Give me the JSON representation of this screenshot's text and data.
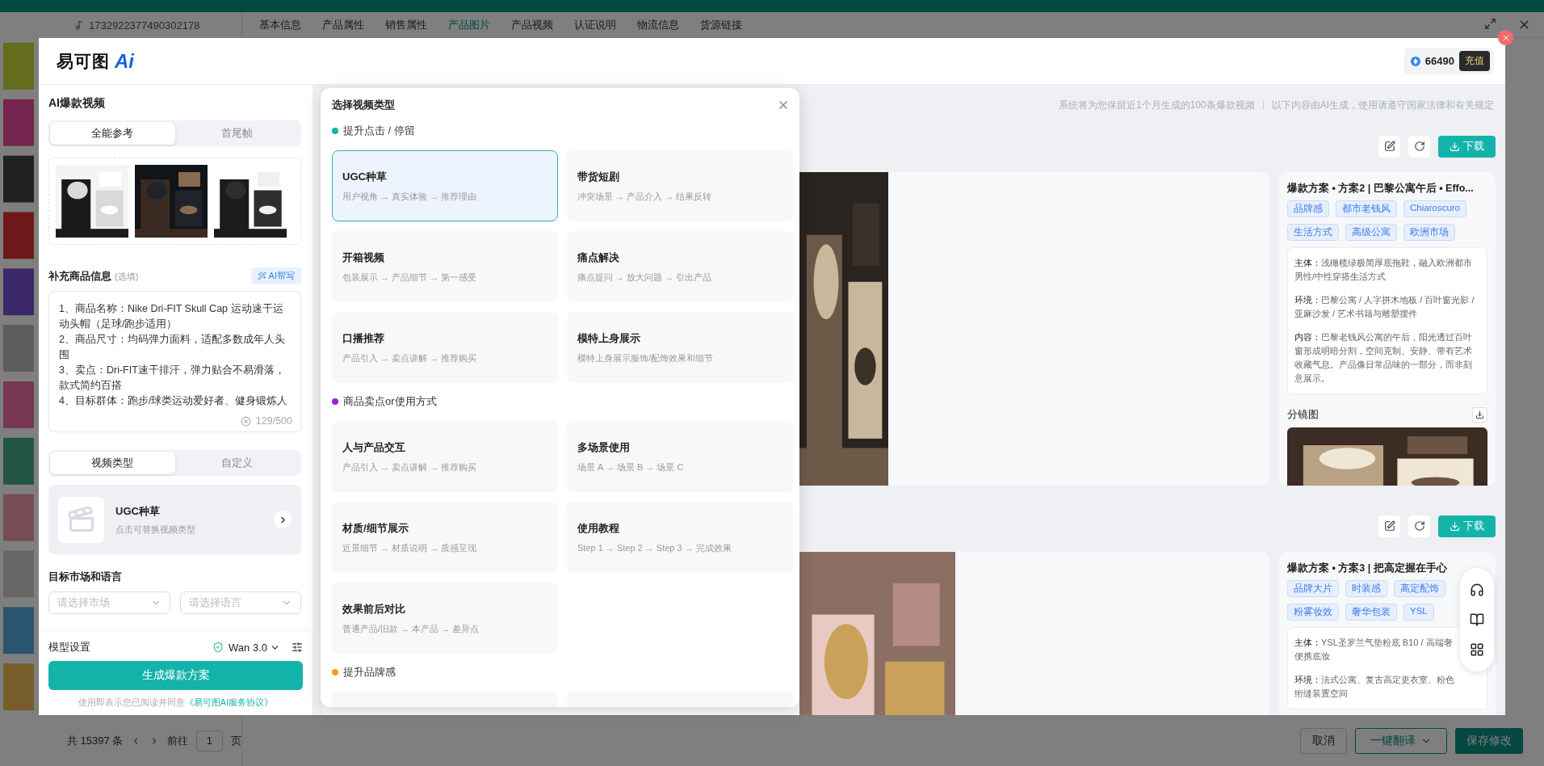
{
  "background_page": {
    "product_id": "1732922377490302178",
    "tabs": [
      {
        "label": "基本信息",
        "selected": false
      },
      {
        "label": "产品属性",
        "selected": false
      },
      {
        "label": "销售属性",
        "selected": false
      },
      {
        "label": "产品图片",
        "selected": true
      },
      {
        "label": "产品视频",
        "selected": false
      },
      {
        "label": "认证说明",
        "selected": false
      },
      {
        "label": "物流信息",
        "selected": false
      },
      {
        "label": "货源链接",
        "selected": false
      }
    ],
    "pagination": {
      "total": "共 15397 条",
      "goto": "前往",
      "page": "1",
      "unit": "页"
    },
    "buttons": [
      {
        "label": "取消",
        "kind": "plain"
      },
      {
        "label": "一键翻译",
        "kind": "dropdown"
      },
      {
        "label": "保存修改",
        "kind": "primary"
      }
    ]
  },
  "modal": {
    "logo": {
      "text": "易可图",
      "mark": "Ai"
    },
    "credits": "66490",
    "recharge": "充值"
  },
  "left_panel": {
    "title": "AI爆款视频",
    "mode_tabs": [
      {
        "label": "全能参考",
        "selected": true
      },
      {
        "label": "首尾帧",
        "selected": false
      }
    ],
    "info": {
      "label": "补充商品信息",
      "hint": "(选填)",
      "ai_button": "AI帮写",
      "value": "1、商品名称：Nike Dri-FIT Skull Cap 运动速干运动头帽（足球/跑步适用）\n2、商品尺寸：均码弹力面料，适配多数成年人头围\n3、卖点：Dri-FIT速干排汗，弹力贴合不易滑落，款式简约百搭\n4、目标群体：跑步/球类运动爱好者、健身锻炼人",
      "counter": "129/500"
    },
    "type_tabs": [
      {
        "label": "视频类型",
        "selected": true
      },
      {
        "label": "自定义",
        "selected": false
      }
    ],
    "selected_type": {
      "name": "UGC种草",
      "hint": "点击可替换视频类型"
    },
    "market": {
      "label": "目标市场和语言",
      "selects": [
        {
          "placeholder": "请选择市场"
        },
        {
          "placeholder": "请选择语言"
        }
      ]
    },
    "model": {
      "label": "模型设置",
      "value": "Wan 3.0"
    },
    "generate_button": "生成爆款方案",
    "agreement": {
      "text": "使用即表示您已阅读并同意",
      "link": "《易可图AI服务协议》"
    }
  },
  "popup": {
    "title": "选择视频类型",
    "sections": [
      {
        "title": "提升点击 / 停留",
        "color": "#14b3aa",
        "cards": [
          {
            "name": "UGC种草",
            "flow": "用户视角 → 真实体验 → 推荐理由",
            "selected": true
          },
          {
            "name": "带货短剧",
            "flow": "冲突场景 → 产品介入 → 结果反转",
            "selected": false
          },
          {
            "name": "开箱视频",
            "flow": "包装展示 → 产品细节 → 第一感受",
            "selected": false
          },
          {
            "name": "痛点解决",
            "flow": "痛点提问 → 放大问题 → 引出产品",
            "selected": false
          },
          {
            "name": "口播推荐",
            "flow": "产品引入 → 卖点讲解 → 推荐购买",
            "selected": false
          },
          {
            "name": "模特上身展示",
            "flow": "模特上身展示服饰/配饰效果和细节",
            "selected": false
          }
        ]
      },
      {
        "title": "商品卖点or使用方式",
        "color": "#9b1fe0",
        "cards": [
          {
            "name": "人与产品交互",
            "flow": "产品引入 → 卖点讲解 → 推荐购买",
            "selected": false
          },
          {
            "name": "多场景使用",
            "flow": "场景 A → 场景 B → 场景 C",
            "selected": false
          },
          {
            "name": "材质/细节展示",
            "flow": "近景细节 → 材质说明 → 质感呈现",
            "selected": false
          },
          {
            "name": "使用教程",
            "flow": "Step 1 → Step 2 → Step 3 → 完成效果",
            "selected": false
          },
          {
            "name": "效果前后对比",
            "flow": "普通产品/旧款 → 本产品 → 差异点",
            "selected": false
          }
        ]
      },
      {
        "title": "提升品牌感",
        "color": "#ff9a1f",
        "cards": [
          {
            "selected": false
          },
          {
            "selected": false
          }
        ]
      }
    ]
  },
  "results": {
    "notices": [
      "系统将为您保留近1个月生成的100条爆款视频",
      "以下内容由AI生成，使用请遵守国家法律和有关规定"
    ],
    "items": [
      {
        "download": "下载",
        "title": "爆款方案 • 方案2 | 巴黎公寓午后 • Effo...",
        "tags": [
          "品牌感",
          "都市老钱风",
          "Chiaroscuro",
          "生活方式",
          "高级公寓",
          "欧洲市场"
        ],
        "details": [
          {
            "label": "主体：",
            "text": "浅橄榄绿极简厚底拖鞋，融入欧洲都市男性/中性穿搭生活方式"
          },
          {
            "label": "环境：",
            "text": "巴黎公寓 / 人字拼木地板 / 百叶窗光影 / 亚麻沙发 / 艺术书籍与雕塑摆件"
          },
          {
            "label": "内容：",
            "text": "巴黎老钱风公寓的午后，阳光透过百叶窗形成明暗分割，空间克制、安静、带有艺术收藏气息。产品像日常品味的一部分，而非刻意展示。"
          }
        ],
        "storyboard_label": "分镜图"
      },
      {
        "download": "下载",
        "title": "爆款方案 • 方案3 | 把高定握在手心",
        "tags": [
          "品牌大片",
          "时装感",
          "高定配饰",
          "粉雾妆效",
          "奢华包装",
          "YSL"
        ],
        "details": [
          {
            "label": "主体：",
            "text": "YSL圣罗兰气垫粉底 B10 / 高端奢便携底妆"
          },
          {
            "label": "环境：",
            "text": "法式公寓、复古高定更衣室、粉色绗缝装置空间"
          }
        ]
      }
    ]
  }
}
